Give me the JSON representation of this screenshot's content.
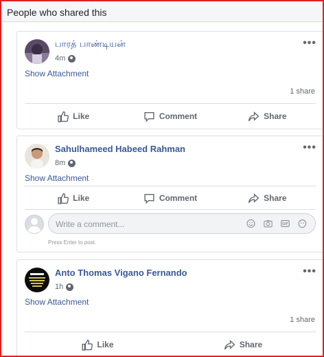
{
  "dialog": {
    "title": "People who shared this"
  },
  "posts": [
    {
      "author": "பாரத் பாண்டியன்",
      "time": "4m",
      "attachment_label": "Show Attachment",
      "share_count": "1 share",
      "actions": {
        "like": "Like",
        "comment": "Comment",
        "share": "Share"
      }
    },
    {
      "author": "Sahulhameed Habeed Rahman",
      "time": "8m",
      "attachment_label": "Show Attachment",
      "actions": {
        "like": "Like",
        "comment": "Comment",
        "share": "Share"
      },
      "comment_placeholder": "Write a comment...",
      "comment_hint": "Press Enter to post."
    },
    {
      "author": "Anto Thomas Vigano Fernando",
      "time": "1h",
      "attachment_label": "Show Attachment",
      "share_count": "1 share",
      "actions": {
        "like": "Like",
        "share": "Share"
      }
    }
  ],
  "icons": {
    "more": "more-options-icon",
    "globe": "public-globe-icon",
    "like": "thumbs-up-icon",
    "comment": "comment-bubble-icon",
    "share": "share-arrow-icon"
  },
  "colors": {
    "link": "#385898",
    "frame_border": "#e02020",
    "muted": "#606770"
  }
}
